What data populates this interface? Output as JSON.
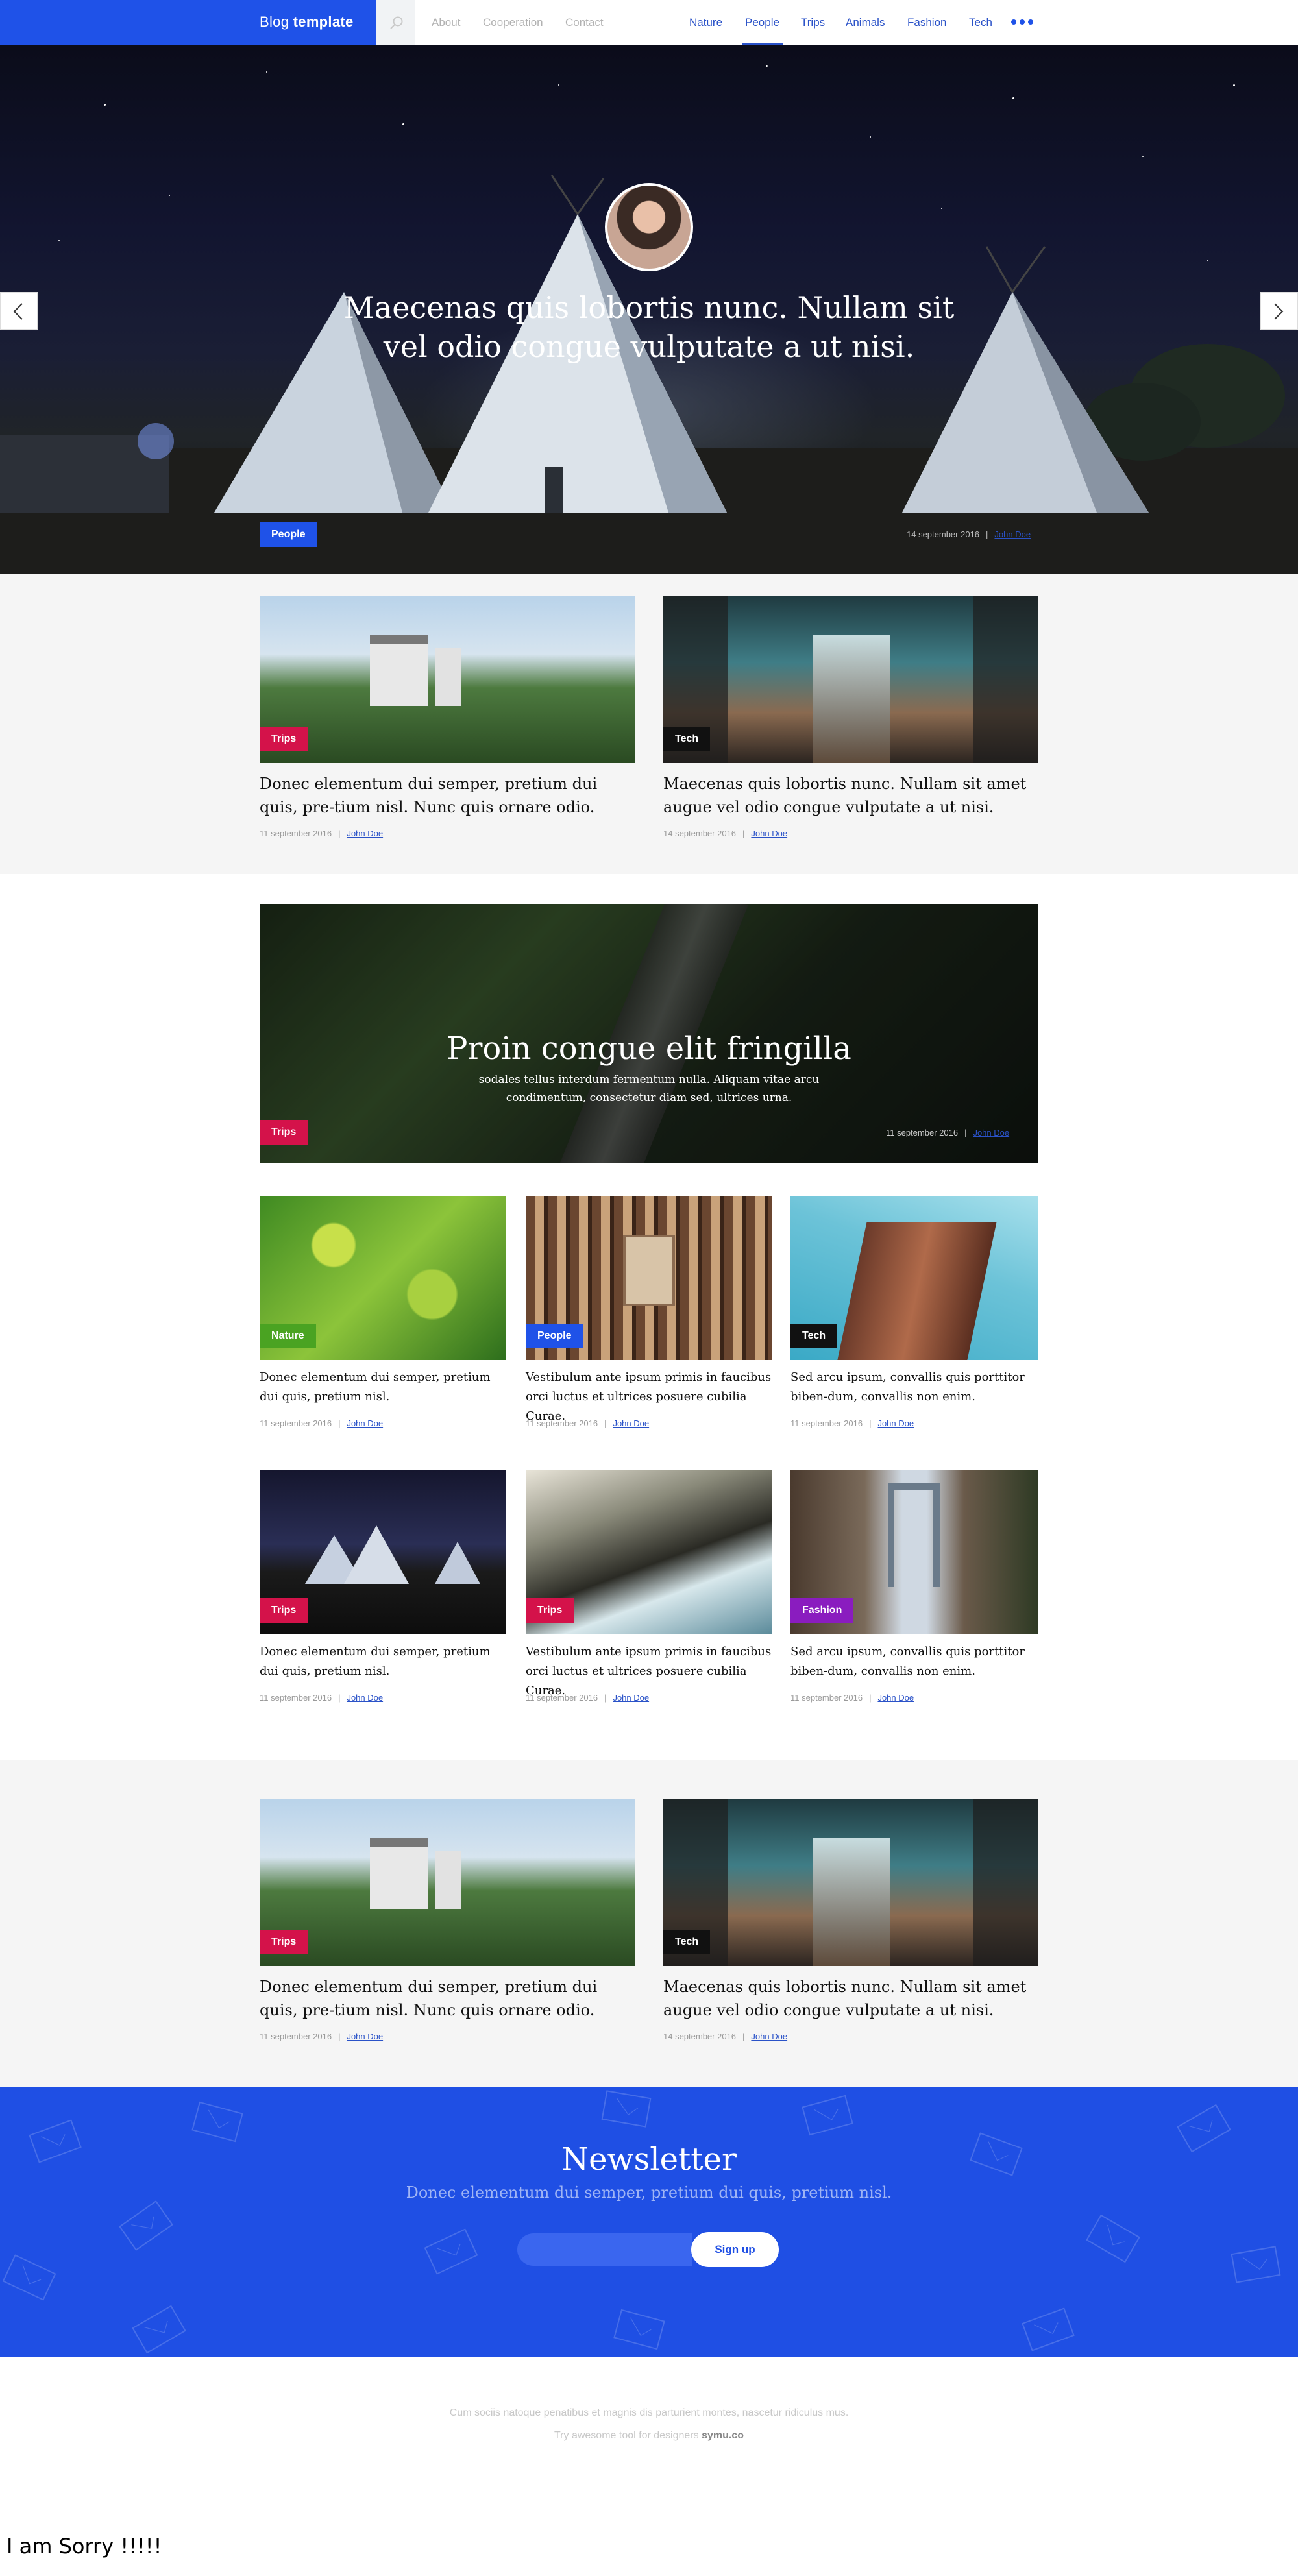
{
  "header": {
    "brand_light": "Blog",
    "brand_bold": "template",
    "left_nav": [
      "About",
      "Cooperation",
      "Contact"
    ],
    "right_nav": [
      "Nature",
      "People",
      "Trips",
      "Animals",
      "Fashion",
      "Tech"
    ],
    "active_item": "People",
    "icons": {
      "search": "search-icon",
      "more": "more-dots-icon"
    },
    "accent_color": "#1f52e8"
  },
  "hero": {
    "title": "Maecenas quis lobortis nunc. Nullam sit vel odio congue vulputate a ut nisi.",
    "tag": "People",
    "date": "14 september 2016",
    "author": "John Doe"
  },
  "tag_colors": {
    "Trips": "#d4124a",
    "Tech": "#111111",
    "Nature": "#4aa322",
    "People": "#1f52e8",
    "Fashion": "#8a1cbf"
  },
  "featured_pair_1": [
    {
      "tag": "Trips",
      "title": "Donec elementum dui semper, pretium dui quis, pre-tium nisl. Nunc quis ornare odio.",
      "date": "11 september 2016",
      "author": "John Doe"
    },
    {
      "tag": "Tech",
      "title": "Maecenas quis lobortis nunc. Nullam sit amet augue vel odio congue vulputate a ut nisi.",
      "date": "14 september 2016",
      "author": "John Doe"
    }
  ],
  "banner": {
    "title": "Proin congue elit fringilla",
    "text": "sodales tellus interdum fermentum nulla. Aliquam vitae arcu condimentum, consectetur diam sed, ultrices urna.",
    "tag": "Trips",
    "date": "11 september 2016",
    "author": "John Doe"
  },
  "grid": [
    {
      "tag": "Nature",
      "title": "Donec elementum dui semper, pretium dui quis, pretium nisl.",
      "date": "11 september 2016",
      "author": "John Doe"
    },
    {
      "tag": "People",
      "title": "Vestibulum ante ipsum primis in faucibus orci luctus et ultrices posuere cubilia Curae.",
      "date": "11 september 2016",
      "author": "John Doe"
    },
    {
      "tag": "Tech",
      "title": "Sed arcu ipsum, convallis quis porttitor biben-dum, convallis non enim.",
      "date": "11 september 2016",
      "author": "John Doe"
    },
    {
      "tag": "Trips",
      "title": "Donec elementum dui semper, pretium dui quis, pretium nisl.",
      "date": "11 september 2016",
      "author": "John Doe"
    },
    {
      "tag": "Trips",
      "title": "Vestibulum ante ipsum primis in faucibus orci luctus et ultrices posuere cubilia Curae.",
      "date": "11 september 2016",
      "author": "John Doe"
    },
    {
      "tag": "Fashion",
      "title": "Sed arcu ipsum, convallis quis porttitor biben-dum, convallis non enim.",
      "date": "11 september 2016",
      "author": "John Doe"
    }
  ],
  "featured_pair_2": [
    {
      "tag": "Trips",
      "title": "Donec elementum dui semper, pretium dui quis, pre-tium nisl. Nunc quis ornare odio.",
      "date": "11 september 2016",
      "author": "John Doe"
    },
    {
      "tag": "Tech",
      "title": "Maecenas quis lobortis nunc. Nullam sit amet augue vel odio congue vulputate a ut nisi.",
      "date": "14 september 2016",
      "author": "John Doe"
    }
  ],
  "newsletter": {
    "title": "Newsletter",
    "subtitle": "Donec elementum dui semper, pretium dui quis, pretium nisl.",
    "input_placeholder": "",
    "button": "Sign up"
  },
  "footer": {
    "line1": "Cum sociis natoque penatibus et magnis dis parturient montes, nascetur ridiculus mus.",
    "line2_prefix": "Try awesome tool for designers",
    "line2_brand": "symu.co"
  },
  "overlay_text": "I am Sorry !!!!!"
}
